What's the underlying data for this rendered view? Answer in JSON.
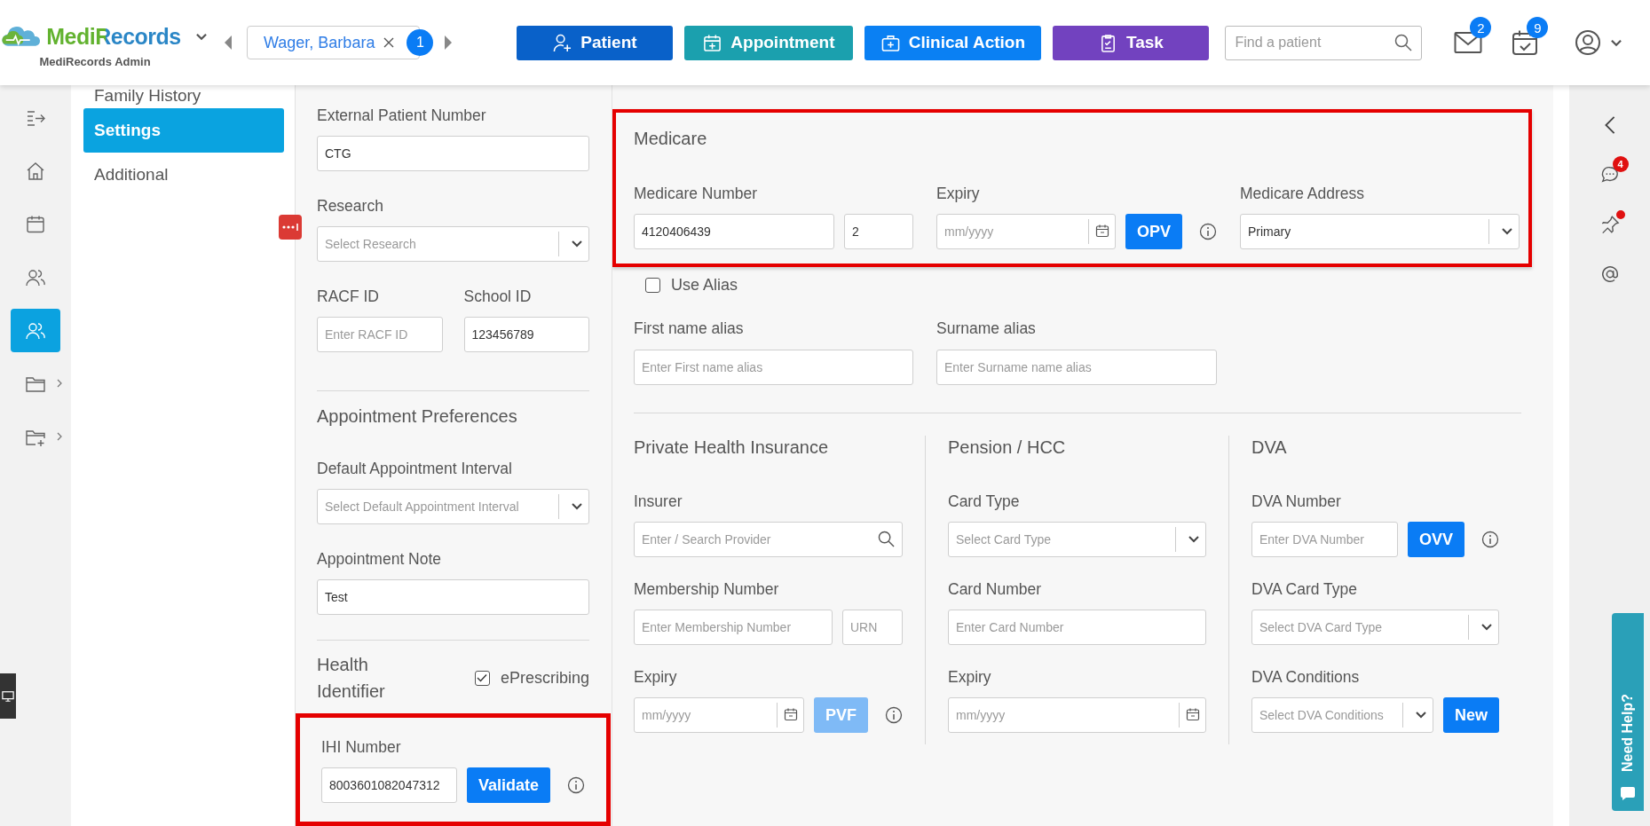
{
  "header": {
    "brand": "MediRecords",
    "subtitle": "MediRecords Admin",
    "patient_tab": {
      "name": "Wager, Barbara",
      "count": "1"
    },
    "actions": [
      {
        "kind": "patient",
        "label": "Patient"
      },
      {
        "kind": "appointment",
        "label": "Appointment"
      },
      {
        "kind": "clinical",
        "label": "Clinical Action"
      },
      {
        "kind": "task",
        "label": "Task"
      }
    ],
    "search": {
      "placeholder": "Find a patient"
    },
    "messages_count": "2",
    "calendar_count": "9"
  },
  "nav": [
    {
      "kind": "collapse",
      "selected": false,
      "submenu": false
    },
    {
      "kind": "home",
      "selected": false,
      "submenu": false
    },
    {
      "kind": "calendar",
      "selected": false,
      "submenu": false
    },
    {
      "kind": "contacts",
      "selected": false,
      "submenu": false
    },
    {
      "kind": "patients",
      "selected": true,
      "submenu": false
    },
    {
      "kind": "folder",
      "selected": false,
      "submenu": true
    },
    {
      "kind": "folder-add",
      "selected": false,
      "submenu": true
    }
  ],
  "sections": [
    {
      "label": "Family History",
      "selected": false
    },
    {
      "label": "Settings",
      "selected": true
    },
    {
      "label": "Additional",
      "selected": false
    }
  ],
  "details": {
    "external": {
      "label": "External Patient Number",
      "field": {
        "kind": "text",
        "value": "CTG"
      }
    },
    "research": {
      "label": "Research",
      "field": {
        "kind": "select",
        "placeholder": "Select Research"
      }
    },
    "ids": [
      {
        "label": "RACF ID",
        "field": {
          "kind": "text",
          "placeholder": "Enter RACF ID"
        }
      },
      {
        "label": "School ID",
        "field": {
          "kind": "text",
          "value": "123456789"
        }
      }
    ],
    "appointment": {
      "title": "Appointment Preferences",
      "interval": {
        "label": "Default Appointment Interval",
        "field": {
          "kind": "select",
          "placeholder": "Select Default Appointment Interval"
        }
      },
      "note": {
        "label": "Appointment Note",
        "field": {
          "kind": "text",
          "value": "Test"
        }
      }
    },
    "health": {
      "title": "Health Identifier",
      "eprescribing": {
        "label": "ePrescribing",
        "checked": true
      },
      "highlighted": true,
      "ihi": {
        "label": "IHI Number",
        "field": {
          "kind": "text",
          "value": "8003601082047312"
        },
        "button": {
          "label": "Validate",
          "disabled": false
        }
      }
    }
  },
  "main": {
    "medicare": {
      "highlighted": true,
      "title": "Medicare",
      "rows": [
        {
          "label": "Medicare Number",
          "fields": [
            {
              "kind": "text",
              "value": "4120406439"
            },
            {
              "kind": "text",
              "value": "2"
            }
          ],
          "info_icon": false
        },
        {
          "label": "Expiry",
          "fields": [
            {
              "kind": "date",
              "placeholder": "mm/yyyy"
            }
          ],
          "button": {
            "label": "OPV",
            "disabled": false
          },
          "info_icon": true
        },
        {
          "label": "Medicare Address",
          "fields": [
            {
              "kind": "select",
              "value": "Primary"
            }
          ],
          "info_icon": false
        }
      ]
    },
    "use_alias": {
      "label": "Use Alias",
      "checked": false
    },
    "alias": [
      {
        "label": "First name alias",
        "fields": [
          {
            "kind": "text",
            "placeholder": "Enter First name alias"
          }
        ]
      },
      {
        "label": "Surname alias",
        "fields": [
          {
            "kind": "text",
            "placeholder": "Enter Surname name alias"
          }
        ]
      }
    ],
    "columns": [
      {
        "title": "Private Health Insurance",
        "rows": [
          {
            "label": "Insurer",
            "fields": [
              {
                "kind": "search",
                "placeholder": "Enter / Search Provider"
              }
            ],
            "info_icon": false
          },
          {
            "label": "Membership Number",
            "fields": [
              {
                "kind": "text",
                "placeholder": "Enter Membership Number"
              },
              {
                "kind": "text",
                "placeholder": "URN"
              }
            ],
            "info_icon": false
          },
          {
            "label": "Expiry",
            "fields": [
              {
                "kind": "date",
                "placeholder": "mm/yyyy"
              }
            ],
            "button": {
              "label": "PVF",
              "disabled": true
            },
            "info_icon": true
          }
        ]
      },
      {
        "title": "Pension / HCC",
        "rows": [
          {
            "label": "Card Type",
            "fields": [
              {
                "kind": "select",
                "placeholder": "Select Card Type"
              }
            ],
            "info_icon": false
          },
          {
            "label": "Card Number",
            "fields": [
              {
                "kind": "text",
                "placeholder": "Enter Card Number"
              }
            ],
            "info_icon": false
          },
          {
            "label": "Expiry",
            "fields": [
              {
                "kind": "date",
                "placeholder": "mm/yyyy"
              }
            ],
            "info_icon": false
          }
        ]
      },
      {
        "title": "DVA",
        "rows": [
          {
            "label": "DVA Number",
            "fields": [
              {
                "kind": "text",
                "placeholder": "Enter DVA Number"
              }
            ],
            "button": {
              "label": "OVV",
              "disabled": false
            },
            "info_icon": true
          },
          {
            "label": "DVA Card Type",
            "fields": [
              {
                "kind": "select",
                "placeholder": "Select DVA Card Type"
              }
            ],
            "info_icon": false
          },
          {
            "label": "DVA Conditions",
            "fields": [
              {
                "kind": "select",
                "placeholder": "Select DVA Conditions"
              }
            ],
            "button": {
              "label": "New",
              "disabled": false
            },
            "info_icon": false
          }
        ]
      }
    ]
  },
  "side_panel": {
    "chat_count": "4",
    "pin_alert": true,
    "help_label": "Need Help?"
  }
}
